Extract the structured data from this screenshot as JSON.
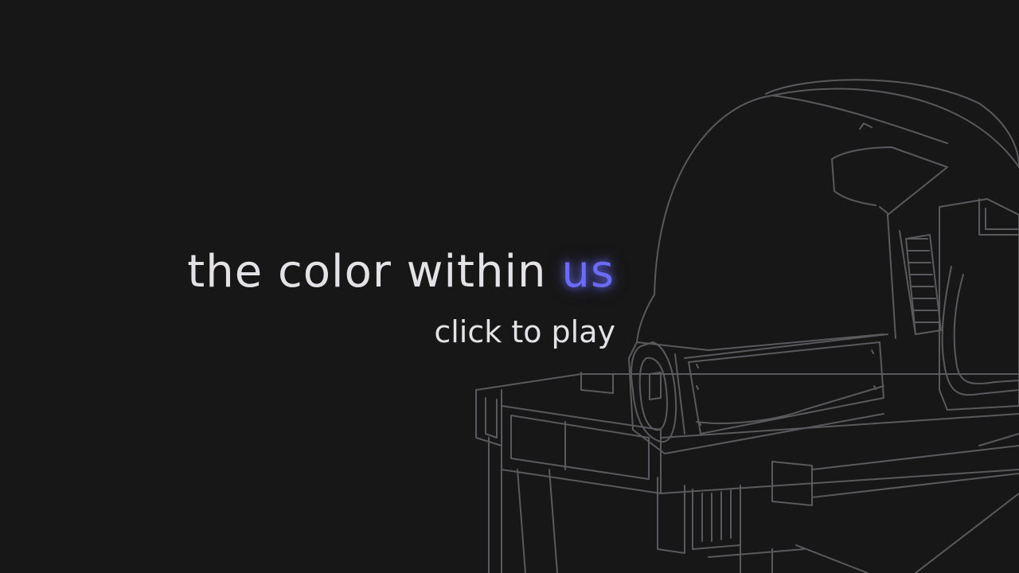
{
  "title": {
    "main": "the color within",
    "accent": "us"
  },
  "play_prompt": "click to play",
  "colors": {
    "background": "#171717",
    "text": "#e4e2e6",
    "accent": "#6b6cf5",
    "line_art": "#5a5a5e"
  },
  "illustration": {
    "icon": "helmet-on-crate-line-art"
  }
}
